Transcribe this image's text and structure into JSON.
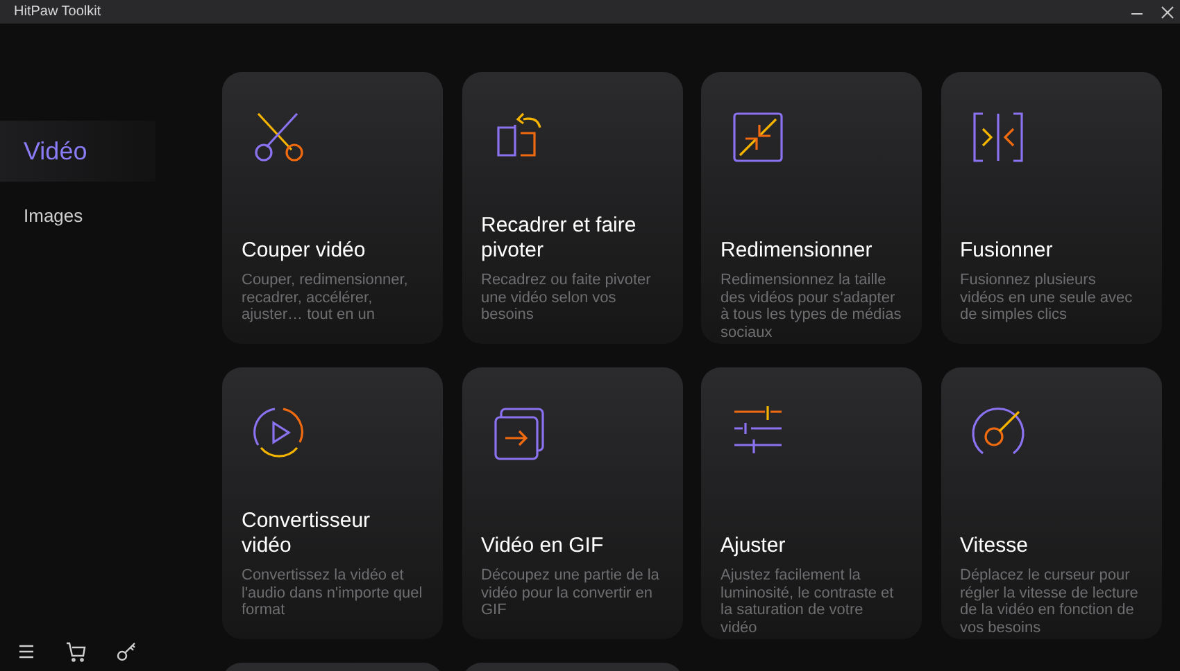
{
  "window": {
    "title": "HitPaw Toolkit"
  },
  "sidebar": {
    "items": [
      {
        "label": "Vidéo",
        "selected": true
      },
      {
        "label": "Images",
        "selected": false
      }
    ]
  },
  "cards": [
    {
      "kind": "scissors",
      "title": "Couper vidéo",
      "description": "Couper, redimensionner, recadrer, accélérer, ajuster… tout en un"
    },
    {
      "kind": "rotate",
      "title": "Recadrer et faire pivoter",
      "description": "Recadrez ou faite pivoter une vidéo selon vos besoins"
    },
    {
      "kind": "resize",
      "title": "Redimensionner",
      "description": "Redimensionnez la taille des vidéos pour s'adapter à tous les types de médias sociaux"
    },
    {
      "kind": "merge",
      "title": "Fusionner",
      "description": "Fusionnez plusieurs vidéos en une seule avec de simples clics"
    },
    {
      "kind": "convert",
      "title": "Convertisseur vidéo",
      "description": "Convertissez la vidéo et l'audio dans n'importe quel format"
    },
    {
      "kind": "gif",
      "title": "Vidéo en GIF",
      "description": "Découpez une partie de la vidéo pour la convertir en GIF"
    },
    {
      "kind": "sliders",
      "title": "Ajuster",
      "description": "Ajustez facilement la luminosité, le contraste et la saturation de votre vidéo"
    },
    {
      "kind": "speed",
      "title": "Vitesse",
      "description": "Déplacez le curseur pour régler la vitesse de lecture de la vidéo en fonction de vos besoins"
    },
    {
      "kind": "partial"
    },
    {
      "kind": "partial"
    }
  ],
  "footer_icons": [
    {
      "kind": "menu"
    },
    {
      "kind": "cart"
    },
    {
      "kind": "key"
    }
  ]
}
